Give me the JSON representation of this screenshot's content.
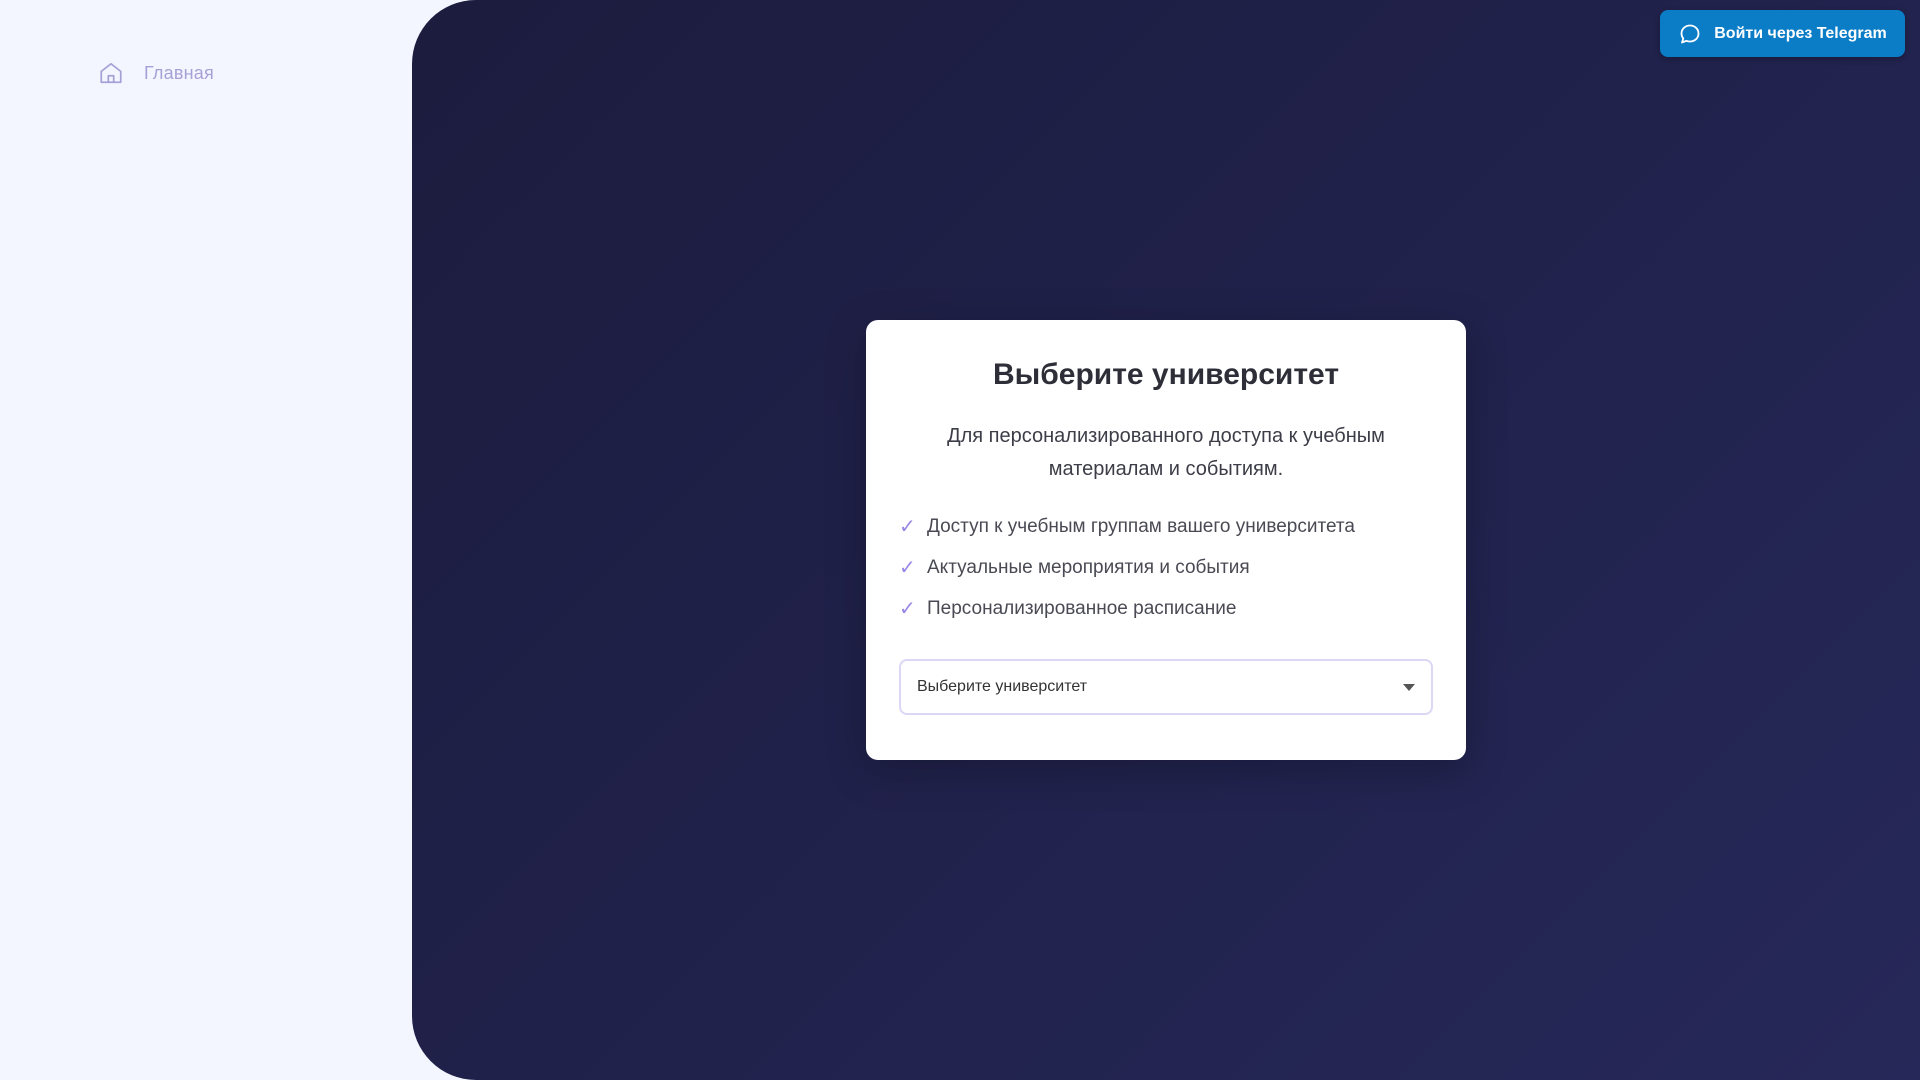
{
  "sidebar": {
    "items": [
      {
        "label": "Главная",
        "icon": "home-icon"
      }
    ]
  },
  "header": {
    "telegram_button": {
      "label": "Войти через Telegram",
      "icon": "chat-bubble-icon"
    }
  },
  "card": {
    "title": "Выберите университет",
    "subtitle": "Для персонализированного доступа к учебным материалам и событиям.",
    "features": [
      "Доступ к учебным группам вашего университета",
      "Актуальные мероприятия и события",
      "Персонализированное расписание"
    ],
    "check_glyph": "✓",
    "select": {
      "value": "Выберите университет"
    }
  },
  "colors": {
    "telegram_blue": "#0b7cc6",
    "panel_dark": "#1f2047",
    "sidebar_bg": "#f4f6ff",
    "accent_purple": "#9a86e6"
  }
}
